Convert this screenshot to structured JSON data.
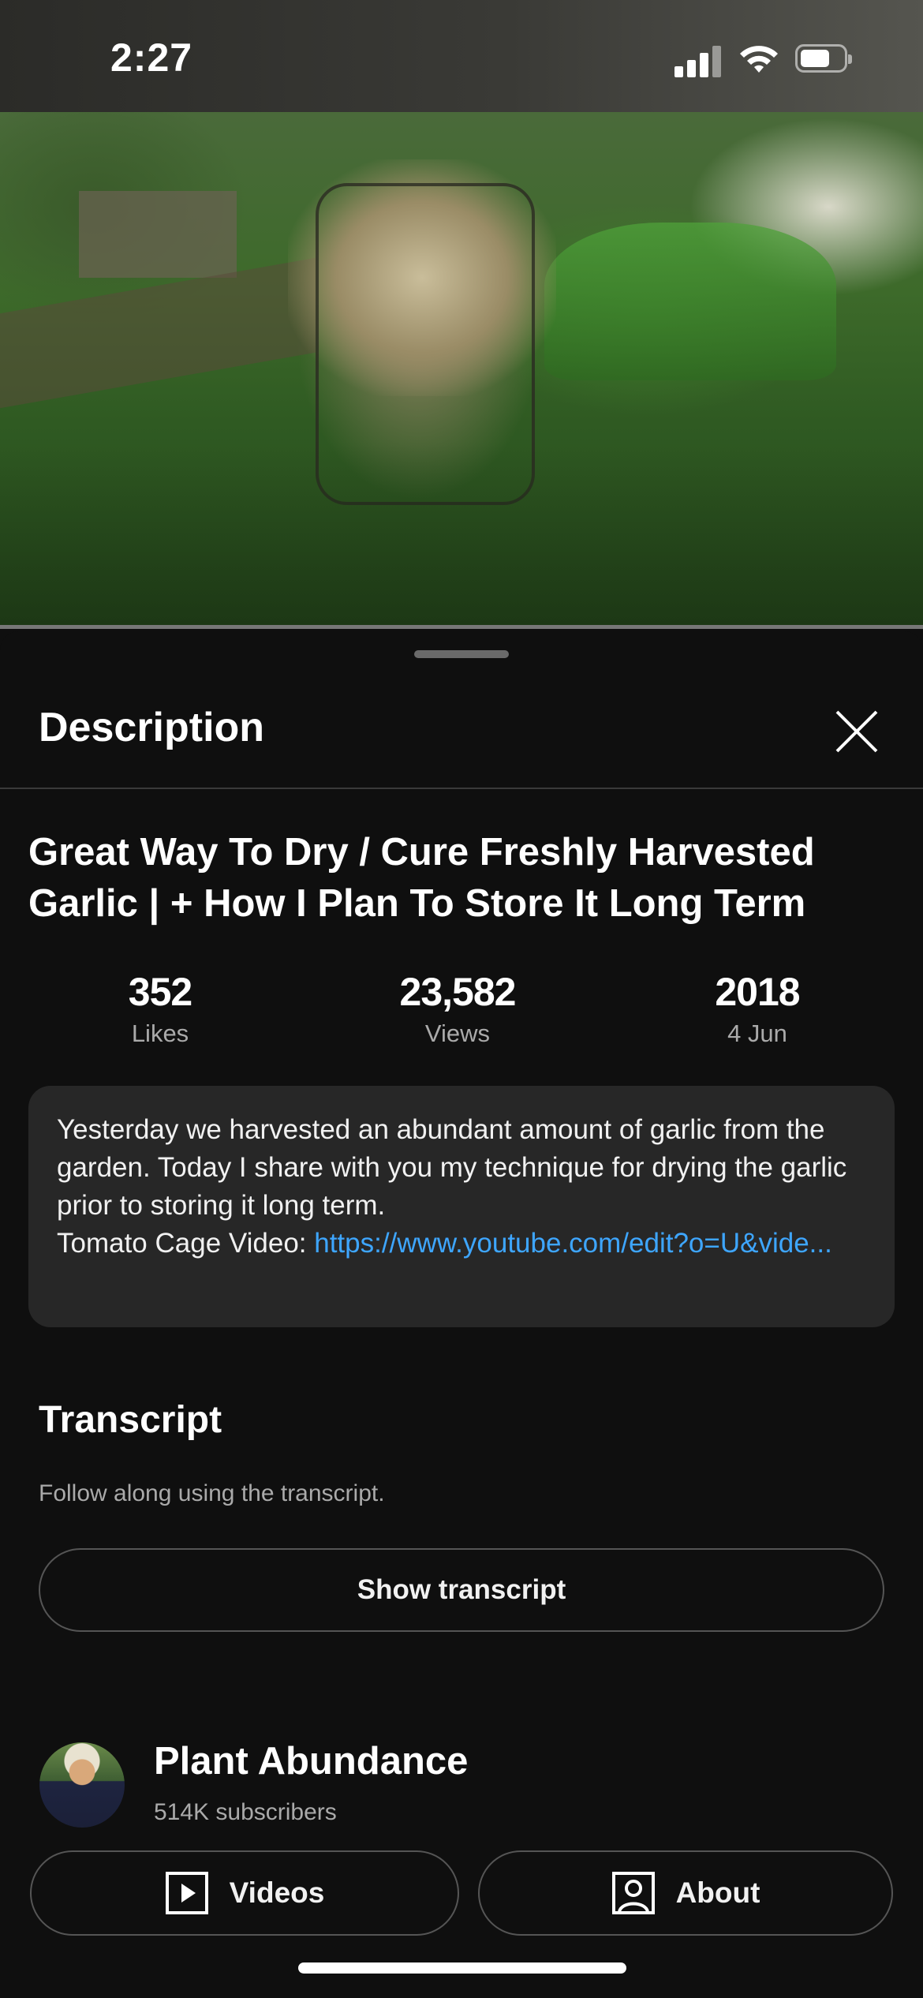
{
  "status_bar": {
    "time": "2:27"
  },
  "sheet": {
    "title": "Description"
  },
  "video": {
    "title": "Great Way To Dry / Cure Freshly Harvested Garlic | + How I Plan To Store It Long Term",
    "stats": [
      {
        "value": "352",
        "label": "Likes"
      },
      {
        "value": "23,582",
        "label": "Views"
      },
      {
        "value": "2018",
        "label": "4 Jun"
      }
    ],
    "description": {
      "text": "Yesterday we harvested an abundant amount of garlic from the garden. Today I share with you my technique for drying the garlic prior to storing it long term.",
      "link_prefix": "Tomato Cage Video: ",
      "link": "https://www.youtube.com/edit?o=U&vide..."
    }
  },
  "transcript": {
    "title": "Transcript",
    "subtitle": "Follow along using the transcript.",
    "button": "Show transcript"
  },
  "channel": {
    "name": "Plant Abundance",
    "subscribers": "514K subscribers",
    "videos_button": "Videos",
    "about_button": "About"
  },
  "colors": {
    "background": "#0f0f0f",
    "card": "#272727",
    "link": "#3ea6ff",
    "secondary_text": "#aaaaaa"
  },
  "icons": [
    "signal-icon",
    "wifi-icon",
    "battery-icon",
    "close-icon",
    "play-icon",
    "person-icon"
  ]
}
